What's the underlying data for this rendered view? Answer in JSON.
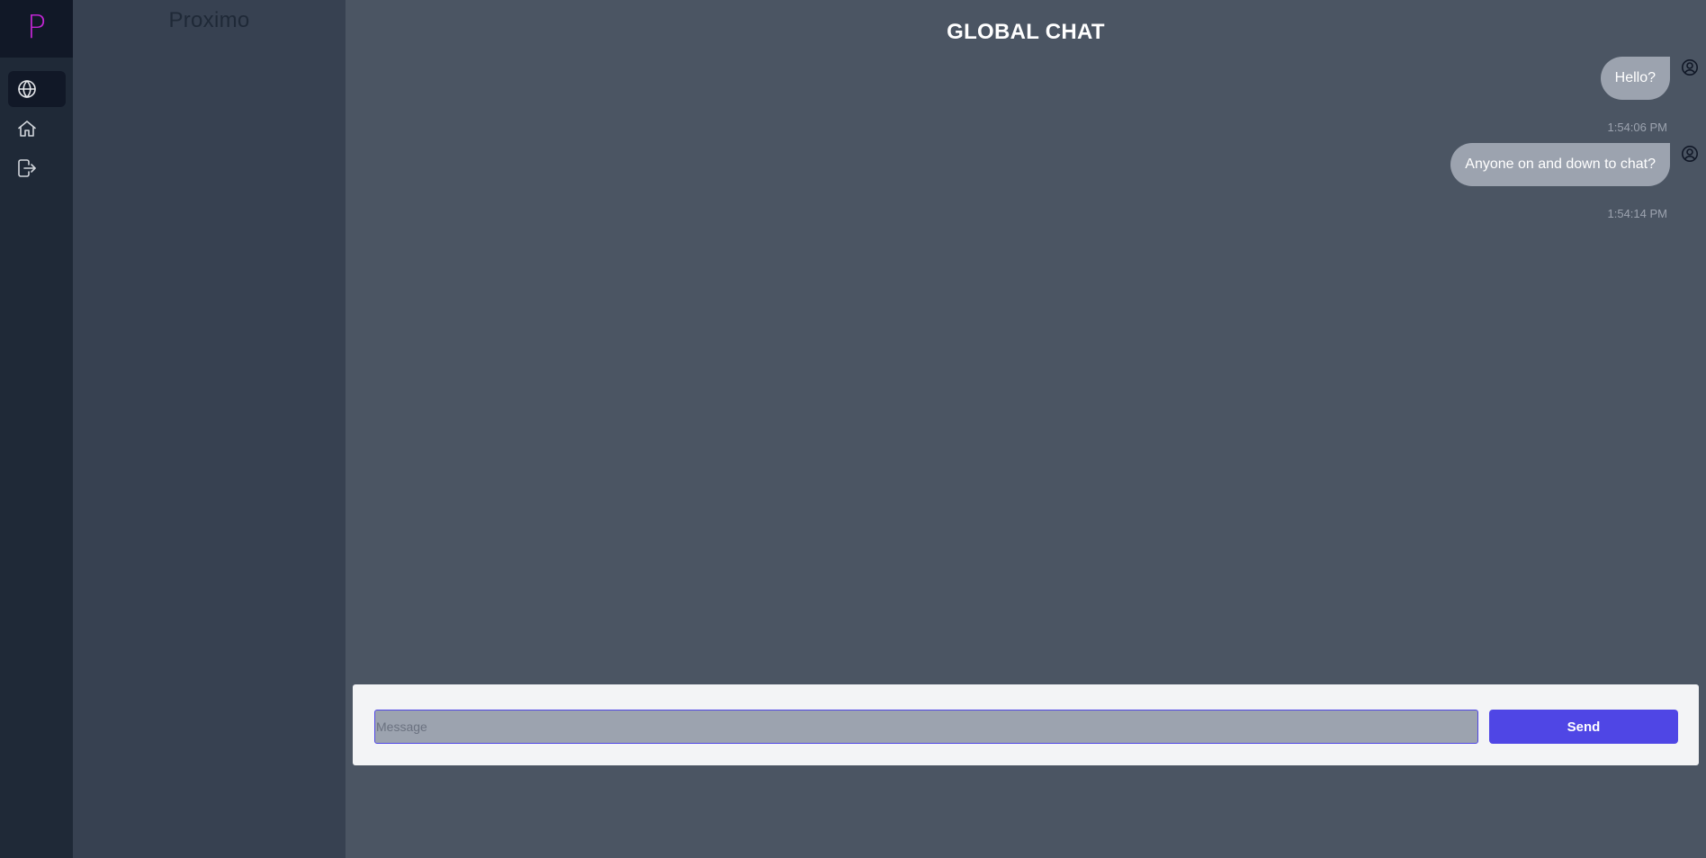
{
  "rail": {
    "logo": "P",
    "nav": [
      {
        "icon": "globe-icon",
        "active": true
      },
      {
        "icon": "home-icon",
        "active": false
      },
      {
        "icon": "logout-icon",
        "active": false
      }
    ]
  },
  "sidebar": {
    "brand": "Proximo"
  },
  "chat": {
    "title": "GLOBAL CHAT",
    "messages": [
      {
        "text": "Hello?",
        "time": "1:54:06 PM"
      },
      {
        "text": "Anyone on and down to chat?",
        "time": "1:54:14 PM"
      }
    ]
  },
  "composer": {
    "placeholder": "Message",
    "send_label": "Send"
  },
  "colors": {
    "accent": "#4f46e5",
    "logo": "#c026d3",
    "bubble": "#9ca3af"
  }
}
